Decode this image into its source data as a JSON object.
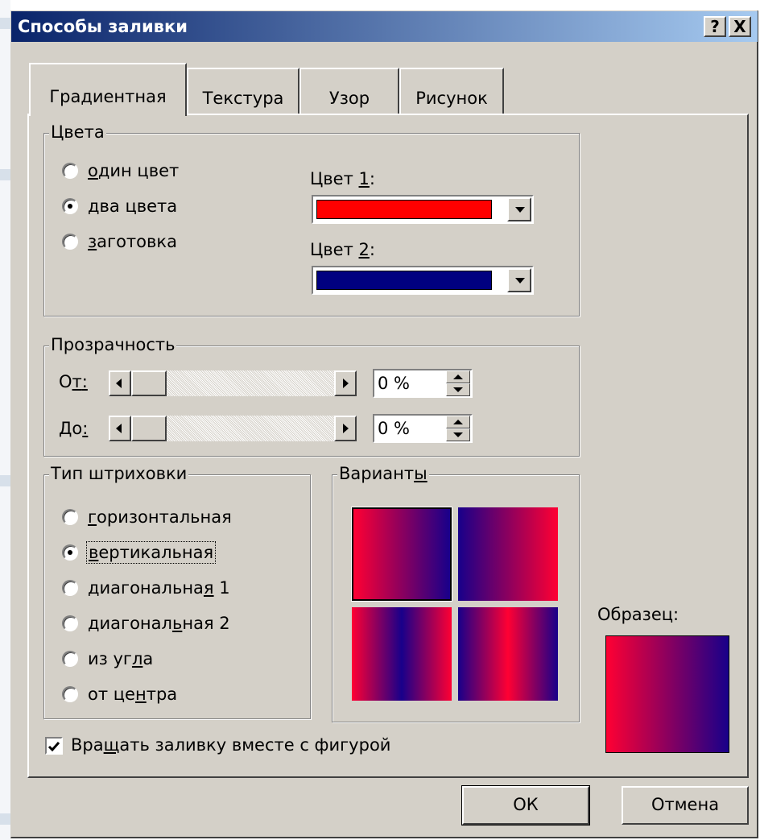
{
  "window": {
    "title": "Способы заливки",
    "help_label": "?",
    "close_label": "X"
  },
  "tabs": [
    {
      "label": "Градиентная",
      "active": true
    },
    {
      "label": "Текстура",
      "active": false
    },
    {
      "label": "Узор",
      "active": false
    },
    {
      "label": "Рисунок",
      "active": false
    }
  ],
  "colors_group": {
    "legend": "Цвета",
    "options": [
      {
        "label_pre": "",
        "mnemonic": "о",
        "label_post": "дин цвет",
        "selected": false
      },
      {
        "label_pre": "",
        "mnemonic": "д",
        "label_post": "ва цвета",
        "selected": true
      },
      {
        "label_pre": "",
        "mnemonic": "з",
        "label_post": "аготовка",
        "selected": false
      }
    ],
    "color1": {
      "label_pre": "Цвет ",
      "mnemonic": "1",
      "label_post": ":",
      "value": "#ff0000"
    },
    "color2": {
      "label_pre": "Цвет ",
      "mnemonic": "2",
      "label_post": ":",
      "value": "#000080"
    }
  },
  "transparency_group": {
    "legend": "Прозрачность",
    "from": {
      "label_pre": "О",
      "mnemonic": "т",
      "label_post": ":",
      "value": "0 %",
      "level": 0
    },
    "to": {
      "label_pre": "До",
      "mnemonic": "",
      "label_post": ":",
      "value": "0 %",
      "level": 0
    }
  },
  "shading_group": {
    "legend": "Тип штриховки",
    "options": [
      {
        "label_pre": "",
        "mnemonic": "г",
        "label_post": "оризонтальная",
        "selected": false
      },
      {
        "label_pre": "",
        "mnemonic": "в",
        "label_post": "ертикальная",
        "selected": true
      },
      {
        "label_pre": "диагональна",
        "mnemonic": "я",
        "label_post": " 1",
        "selected": false
      },
      {
        "label_pre": "диагонал",
        "mnemonic": "ь",
        "label_post": "ная 2",
        "selected": false
      },
      {
        "label_pre": "из уг",
        "mnemonic": "л",
        "label_post": "а",
        "selected": false
      },
      {
        "label_pre": "от це",
        "mnemonic": "н",
        "label_post": "тра",
        "selected": false
      }
    ]
  },
  "variants_group": {
    "legend_pre": "Вариант",
    "legend_mnemonic": "ы",
    "selected_index": 0
  },
  "sample": {
    "label": "Образец:"
  },
  "rotate_checkbox": {
    "label_pre": "Вра",
    "mnemonic": "щ",
    "label_post": "ать заливку вместе с фигурой",
    "checked": true
  },
  "buttons": {
    "ok": "ОК",
    "cancel": "Отмена"
  }
}
